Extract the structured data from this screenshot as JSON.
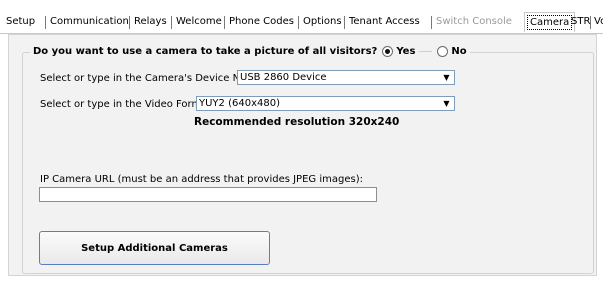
{
  "tabs": [
    {
      "label": "Setup",
      "state": "normal"
    },
    {
      "label": "Communication",
      "state": "normal"
    },
    {
      "label": "Relays",
      "state": "normal"
    },
    {
      "label": "Welcome",
      "state": "normal"
    },
    {
      "label": "Phone Codes",
      "state": "normal"
    },
    {
      "label": "Options",
      "state": "normal"
    },
    {
      "label": "Tenant Access",
      "state": "normal"
    },
    {
      "label": "Switch Console",
      "state": "disabled"
    },
    {
      "label": "Camera",
      "state": "active"
    },
    {
      "label": "STR",
      "state": "normal"
    },
    {
      "label": "VoIP",
      "state": "normal"
    }
  ],
  "camera": {
    "question": "Do you want to use a camera to take a picture of all visitors?",
    "yes_label": "Yes",
    "no_label": "No",
    "selected": "Yes",
    "device_label": "Select or type in the Camera's Device Name:",
    "device_value": "USB 2860 Device",
    "format_label": "Select or type in the Video Format:",
    "format_value": "YUY2 (640x480)",
    "recommended": "Recommended resolution 320x240",
    "ip_url_label": "IP Camera URL (must be an address that provides JPEG images):",
    "ip_url_value": "",
    "setup_button": "Setup Additional Cameras"
  },
  "icons": {
    "dropdown": "chevron-down-icon",
    "radio": "radio-icon"
  }
}
